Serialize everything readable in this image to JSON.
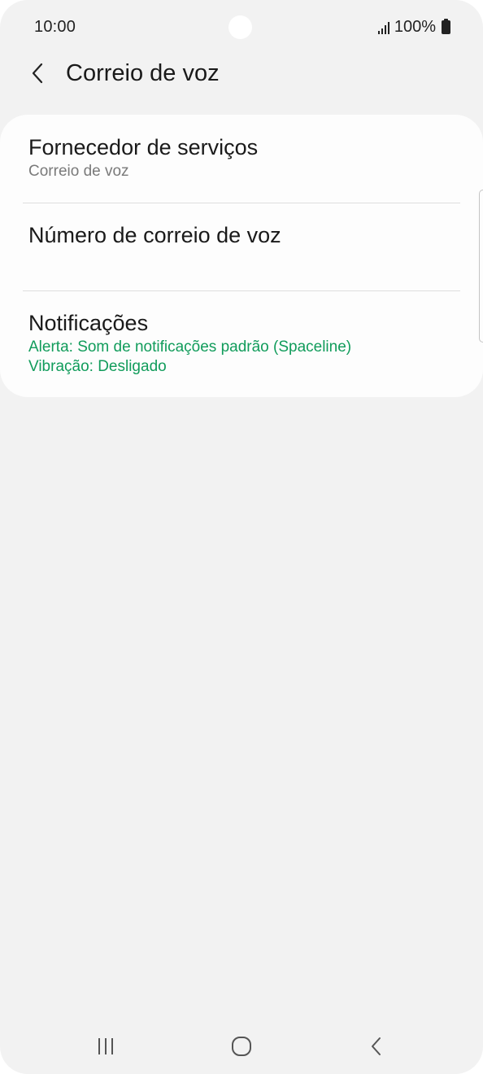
{
  "status_bar": {
    "time": "10:00",
    "battery_text": "100%",
    "icons": [
      "signal-icon",
      "battery-icon"
    ]
  },
  "header": {
    "title": "Correio de voz",
    "back_icon": "chevron-left-icon"
  },
  "settings": {
    "items": [
      {
        "title": "Fornecedor de serviços",
        "subtitle": "Correio de voz"
      },
      {
        "title": "Número de correio de voz"
      },
      {
        "title": "Notificações",
        "lines": [
          "Alerta: Som de notificações padrão (Spaceline)",
          "Vibração: Desligado"
        ]
      }
    ]
  },
  "nav_bar": {
    "icons": [
      "recent-apps-icon",
      "home-icon",
      "back-icon"
    ]
  },
  "colors": {
    "background": "#f2f2f2",
    "card": "#fdfdfd",
    "accent_green": "#119c5b",
    "text_primary": "#1a1a1a",
    "text_secondary": "#7a7a7a"
  }
}
